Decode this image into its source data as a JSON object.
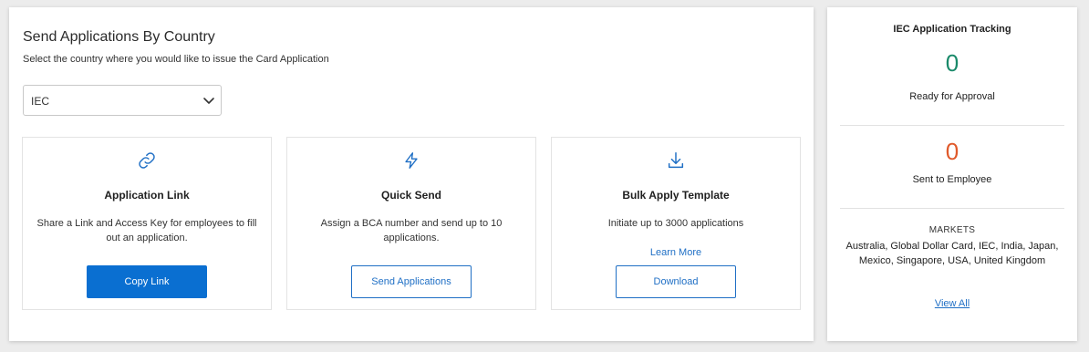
{
  "send": {
    "title": "Send Applications By Country",
    "subtitle": "Select the country where you would like to issue the Card Application",
    "country_selected": "IEC"
  },
  "cards": [
    {
      "icon": "link-icon",
      "title": "Application Link",
      "description": "Share a Link and Access Key for employees to fill out an application.",
      "button": "Copy Link"
    },
    {
      "icon": "lightning-icon",
      "title": "Quick Send",
      "description": "Assign a BCA number and send up to 10 applications.",
      "button": "Send Applications"
    },
    {
      "icon": "download-icon",
      "title": "Bulk Apply Template",
      "description": "Initiate up to 3000 applications",
      "link": "Learn More",
      "button": "Download"
    }
  ],
  "tracking": {
    "title": "IEC Application Tracking",
    "ready_count": "0",
    "ready_label": "Ready for Approval",
    "sent_count": "0",
    "sent_label": "Sent to Employee",
    "markets_title": "MARKETS",
    "markets_list": "Australia, Global Dollar Card, IEC, India, Japan, Mexico, Singapore, USA, United Kingdom",
    "view_all": "View All"
  },
  "colors": {
    "primary_blue": "#0a6fd1",
    "ready_green": "#1a8a6a",
    "sent_orange": "#e05a2b"
  }
}
